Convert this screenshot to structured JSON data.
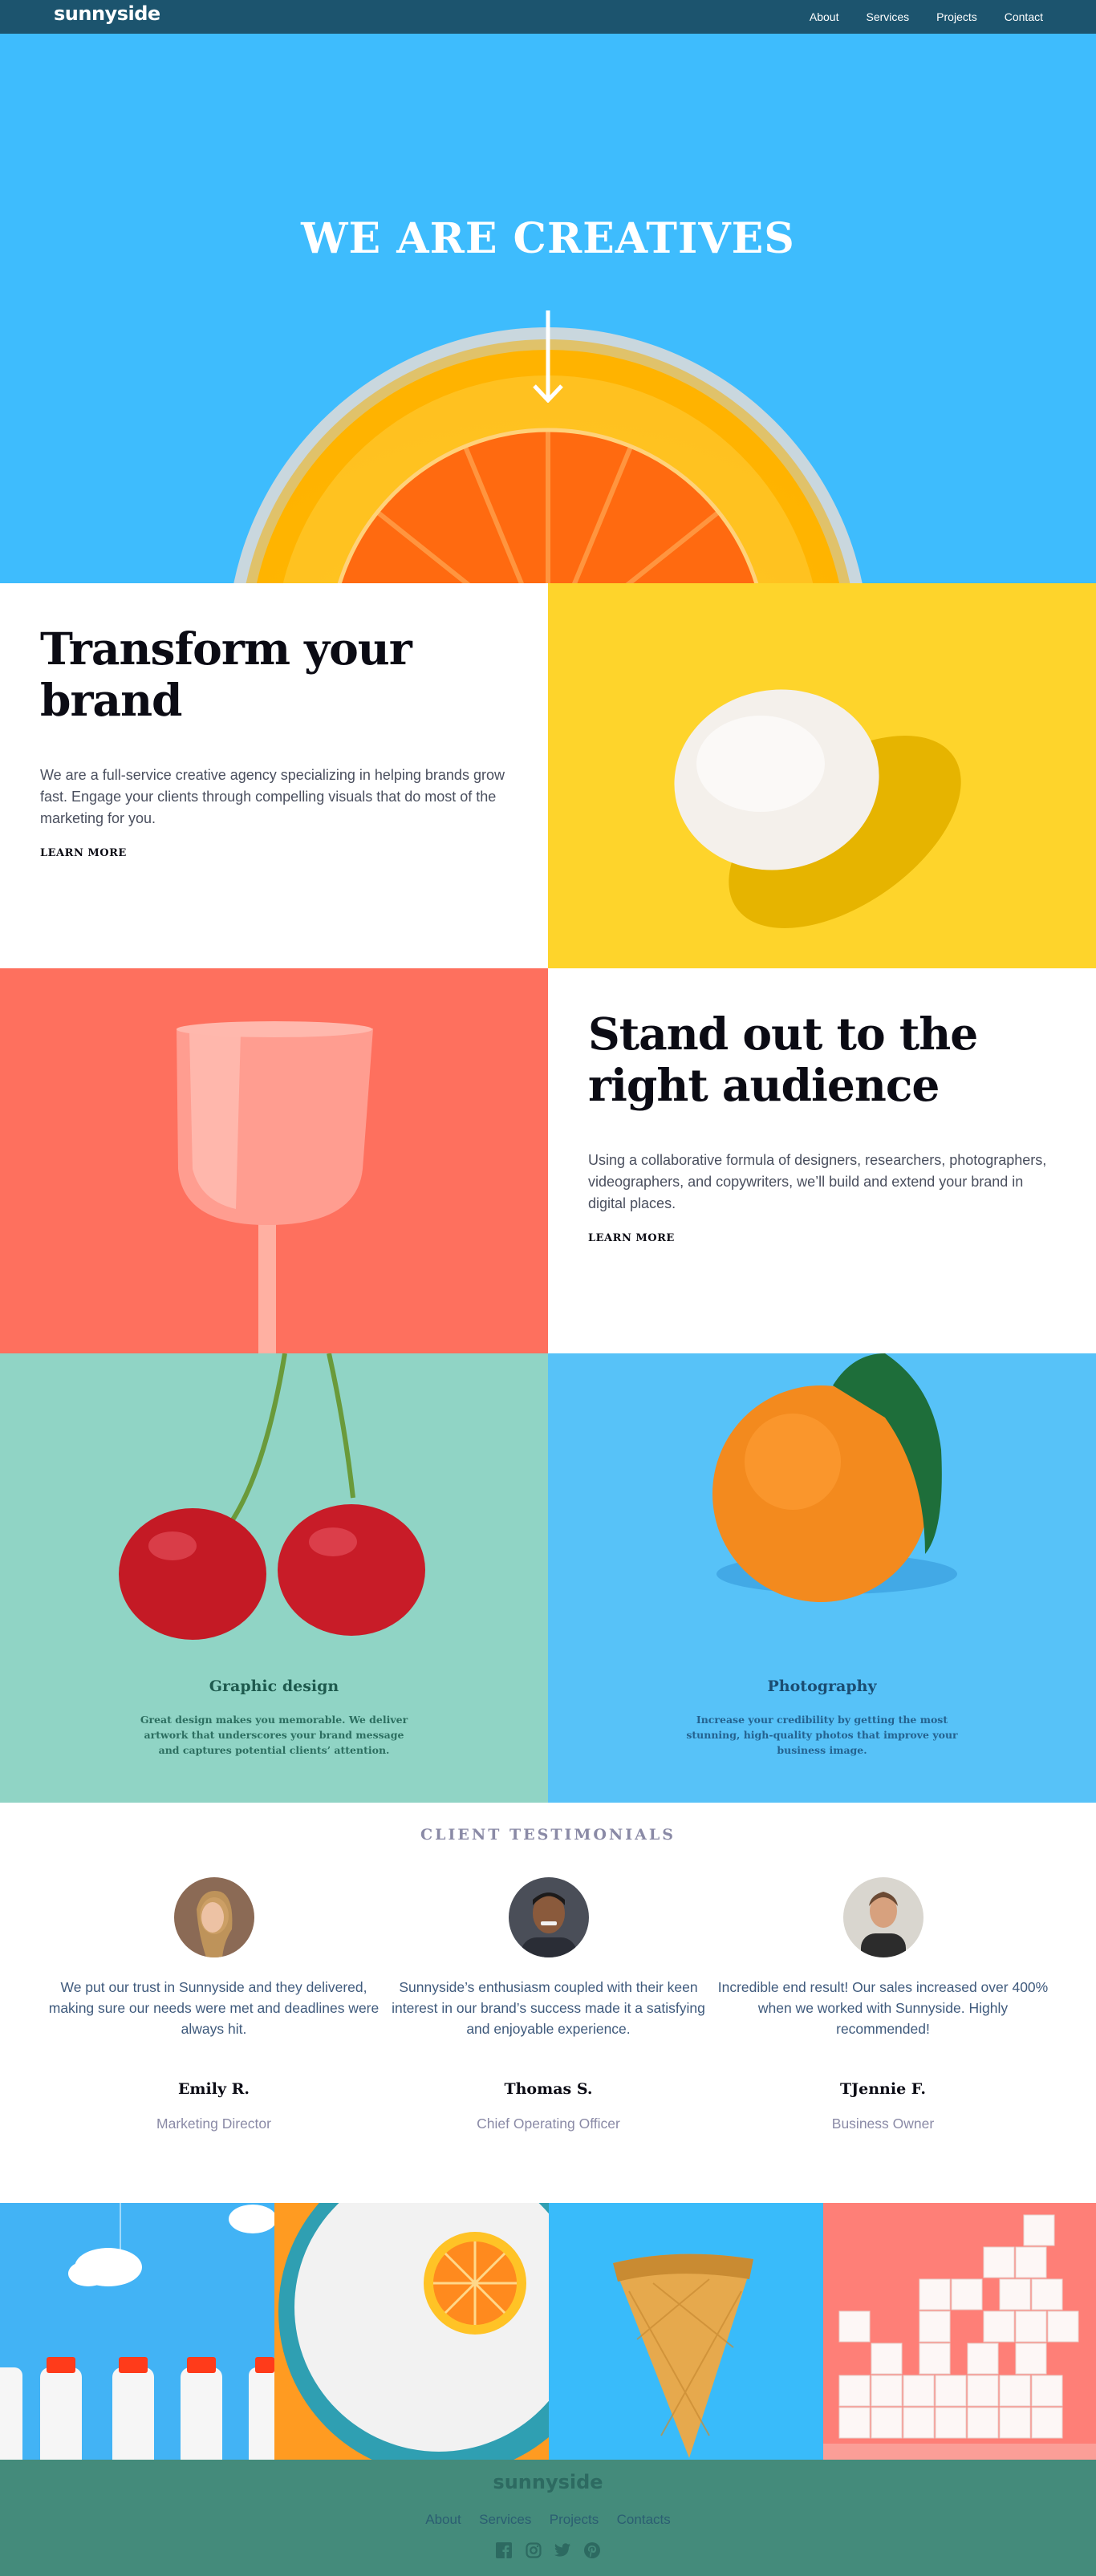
{
  "nav": {
    "logo": "sunnyside",
    "links": [
      "About",
      "Services",
      "Projects",
      "Contact"
    ]
  },
  "hero": {
    "title": "WE ARE CREATIVES",
    "arrow_icon": "arrow-down-icon"
  },
  "transform": {
    "title": "Transform your brand",
    "body": "We are a full-service creative agency specializing in helping brands grow fast. Engage your clients through compelling visuals that do most of the marketing for you.",
    "cta": "LEARN MORE"
  },
  "standout": {
    "title": "Stand out to the right audience",
    "body": "Using a collaborative formula of designers, researchers, photographers, videographers, and copywriters, we’ll build and extend your brand in digital places.",
    "cta": "LEARN MORE"
  },
  "services": [
    {
      "title": "Graphic design",
      "body": "Great design makes you memorable. We deliver artwork that underscores your brand message and captures potential clients’ attention."
    },
    {
      "title": "Photography",
      "body": "Increase your credibility by getting the most stunning, high-quality photos that improve your business image."
    }
  ],
  "testimonials": {
    "heading": "CLIENT TESTIMONIALS",
    "items": [
      {
        "quote": "We put our trust in Sunnyside and they delivered, making sure our needs were met and deadlines were always hit.",
        "name": "Emily R.",
        "role": "Marketing Director"
      },
      {
        "quote": "Sunnyside’s enthusiasm coupled with their keen interest in our brand’s success made it a satisfying and enjoyable experience.",
        "name": "Thomas S.",
        "role": "Chief Operating Officer"
      },
      {
        "quote": "Incredible end result! Our sales increased over 400% when we worked with Sunnyside. Highly recommended!",
        "name": "TJennie F.",
        "role": "Business Owner"
      }
    ]
  },
  "footer": {
    "logo": "sunnyside",
    "links": [
      "About",
      "Services",
      "Projects",
      "Contacts"
    ],
    "social_icons": [
      "facebook-icon",
      "instagram-icon",
      "twitter-icon",
      "pinterest-icon"
    ]
  },
  "colors": {
    "nav_bg": "#1c546e",
    "hero_bg": "#3ebcfd",
    "egg_bg": "#fed42b",
    "glass_bg": "#fe705e",
    "graphic_bg": "#90d4c5",
    "photo_bg": "#57c2f8",
    "footer_bg": "#448b7b"
  }
}
